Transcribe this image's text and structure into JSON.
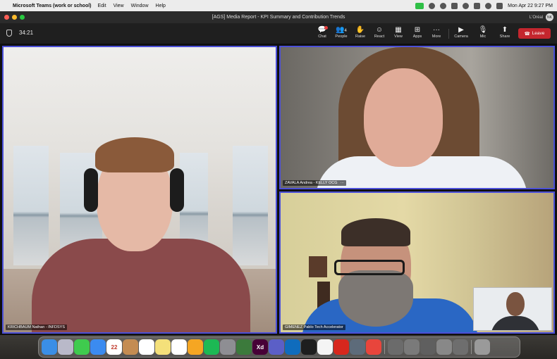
{
  "menubar": {
    "app_name": "Microsoft Teams (work or school)",
    "items": [
      "Edit",
      "View",
      "Window",
      "Help"
    ],
    "clock": "Mon Apr 22  9:27 PM"
  },
  "window": {
    "title": "[AGS] Media Report - KPI Summary and Contribution Trends",
    "org": "L'Oréal",
    "avatar_initials": "NK"
  },
  "toolbar": {
    "timer": "34:21",
    "buttons": [
      {
        "label": "Chat",
        "icon": "chat-icon",
        "glyph": "💬"
      },
      {
        "label": "People",
        "icon": "people-icon",
        "glyph": "👥",
        "count": "4"
      },
      {
        "label": "Raise",
        "icon": "raise-hand-icon",
        "glyph": "✋"
      },
      {
        "label": "React",
        "icon": "react-icon",
        "glyph": "☺"
      },
      {
        "label": "View",
        "icon": "view-icon",
        "glyph": "▦"
      },
      {
        "label": "Apps",
        "icon": "apps-icon",
        "glyph": "⊞"
      },
      {
        "label": "More",
        "icon": "more-icon",
        "glyph": "···"
      },
      {
        "label": "Camera",
        "icon": "camera-icon",
        "glyph": "▶"
      },
      {
        "label": "Mic",
        "icon": "mic-icon",
        "glyph": "🎙"
      },
      {
        "label": "Share",
        "icon": "share-icon",
        "glyph": "⬆"
      }
    ],
    "leave_label": "Leave",
    "leave_color": "#c4262e"
  },
  "participants": [
    {
      "name": "KRICHBAUM Nathan - INFDSYS"
    },
    {
      "name": "ZAVALA Andrea - KELLY OCG"
    },
    {
      "name": "GIMENEZ Pablo Tech Accelerator"
    }
  ],
  "accent_color": "#4b4fd8",
  "dock": {
    "apps": [
      {
        "name": "finder-icon",
        "color": "#3a8ee6",
        "glyph": ""
      },
      {
        "name": "launchpad-icon",
        "color": "#b9b9c9",
        "glyph": ""
      },
      {
        "name": "messages-icon",
        "color": "#3fcb4e",
        "glyph": ""
      },
      {
        "name": "mail-icon",
        "color": "#3b8bf0",
        "glyph": ""
      },
      {
        "name": "calendar-icon",
        "color": "#ffffff",
        "glyph": "22"
      },
      {
        "name": "notes-icon",
        "color": "#c48c52",
        "glyph": ""
      },
      {
        "name": "reminders-icon",
        "color": "#ffffff",
        "glyph": ""
      },
      {
        "name": "stickies-icon",
        "color": "#f4e07a",
        "glyph": ""
      },
      {
        "name": "freeform-icon",
        "color": "#ffffff",
        "glyph": ""
      },
      {
        "name": "pencil-icon",
        "color": "#f5a623",
        "glyph": ""
      },
      {
        "name": "spotify-icon",
        "color": "#1db954",
        "glyph": ""
      },
      {
        "name": "settings-icon",
        "color": "#8e8e93",
        "glyph": ""
      },
      {
        "name": "spreadsheet-icon",
        "color": "#3c7a3c",
        "glyph": ""
      },
      {
        "name": "xd-icon",
        "color": "#470137",
        "glyph": "Xd"
      },
      {
        "name": "teams-icon",
        "color": "#5b5fc7",
        "glyph": ""
      },
      {
        "name": "outlook-icon",
        "color": "#0f6cbd",
        "glyph": ""
      },
      {
        "name": "figma-icon",
        "color": "#1e1e1e",
        "glyph": ""
      },
      {
        "name": "chrome-icon",
        "color": "#f4f4f4",
        "glyph": ""
      },
      {
        "name": "acrobat-icon",
        "color": "#d7271d",
        "glyph": ""
      },
      {
        "name": "screenshot-icon",
        "color": "#5d6b7a",
        "glyph": ""
      },
      {
        "name": "creative-cloud-icon",
        "color": "#e8453c",
        "glyph": ""
      },
      {
        "name": "window-thumb-icon",
        "color": "#6b6b6b",
        "glyph": ""
      },
      {
        "name": "window-thumb-icon",
        "color": "#7a7a7a",
        "glyph": ""
      },
      {
        "name": "window-thumb-icon",
        "color": "#5f5f5f",
        "glyph": ""
      },
      {
        "name": "window-thumb-icon",
        "color": "#888888",
        "glyph": ""
      },
      {
        "name": "window-thumb-icon",
        "color": "#6e6e6e",
        "glyph": ""
      },
      {
        "name": "trash-icon",
        "color": "#9a9a9a",
        "glyph": ""
      }
    ]
  }
}
